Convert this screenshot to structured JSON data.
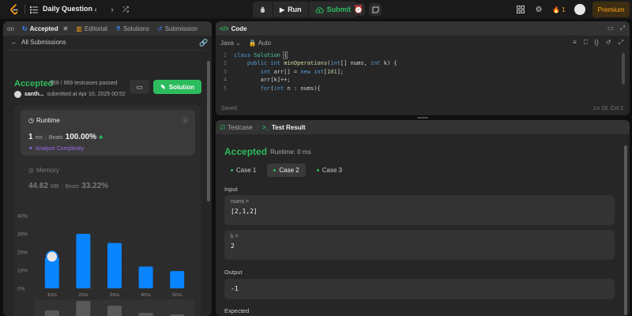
{
  "topnav": {
    "title": "Daily Question",
    "run_label": "Run",
    "submit_label": "Submit",
    "streak": "1",
    "premium_label": "Premium"
  },
  "left": {
    "tabs": [
      {
        "label": "on"
      },
      {
        "label": "Accepted"
      },
      {
        "label": "Editorial"
      },
      {
        "label": "Solutions"
      },
      {
        "label": "Submission"
      }
    ],
    "all_submissions": "All Submissions",
    "status": "Accepted",
    "testcases": "969 / 969 testcases passed",
    "author": "santh...",
    "submitted_at": "submitted at Apr 10, 2025 00:52",
    "solution_label": "Solution",
    "runtime": {
      "label": "Runtime",
      "value": "1",
      "unit": "ms",
      "beats_label": "Beats",
      "beats_value": "100.00%",
      "analyze_label": "Analyze Complexity"
    },
    "memory": {
      "label": "Memory",
      "value": "44.62",
      "unit": "MB",
      "beats_label": "Beats",
      "beats_value": "33.22%"
    }
  },
  "chart_data": {
    "type": "bar",
    "categories": [
      "1ms",
      "2ms",
      "3ms",
      "4ms",
      "5ms"
    ],
    "values": [
      17,
      30,
      25,
      12,
      9.5
    ],
    "ylim": [
      0,
      40
    ],
    "yticks": [
      "0%",
      "10%",
      "20%",
      "30%",
      "40%"
    ],
    "highlight_category": "1ms",
    "mini_labels": [
      "1ms",
      "2ms",
      "3ms",
      "4ms",
      "5ms"
    ],
    "bar_color": "#0a84ff",
    "grid": true
  },
  "code": {
    "tab_label": "Code",
    "language": "Java",
    "mode": "Auto",
    "line_numbers": [
      "1",
      "2",
      "3",
      "4",
      "5"
    ],
    "saved": "Saved",
    "cursor": "Ln 19, Col 2"
  },
  "result": {
    "tab_testcase": "Testcase",
    "tab_result": "Test Result",
    "status": "Accepted",
    "runtime": "Runtime: 0 ms",
    "cases": [
      "Case 1",
      "Case 2",
      "Case 3"
    ],
    "input_label": "Input",
    "param1_name": "nums =",
    "param1_value": "[2,1,2]",
    "param2_name": "k =",
    "param2_value": "2",
    "output_label": "Output",
    "output_value": "-1",
    "expected_label": "Expected"
  },
  "colors": {
    "accent_green": "#2cbb5d",
    "accent_orange": "#ffa116",
    "bar_blue": "#0a84ff",
    "purple": "#9c6cf0"
  }
}
